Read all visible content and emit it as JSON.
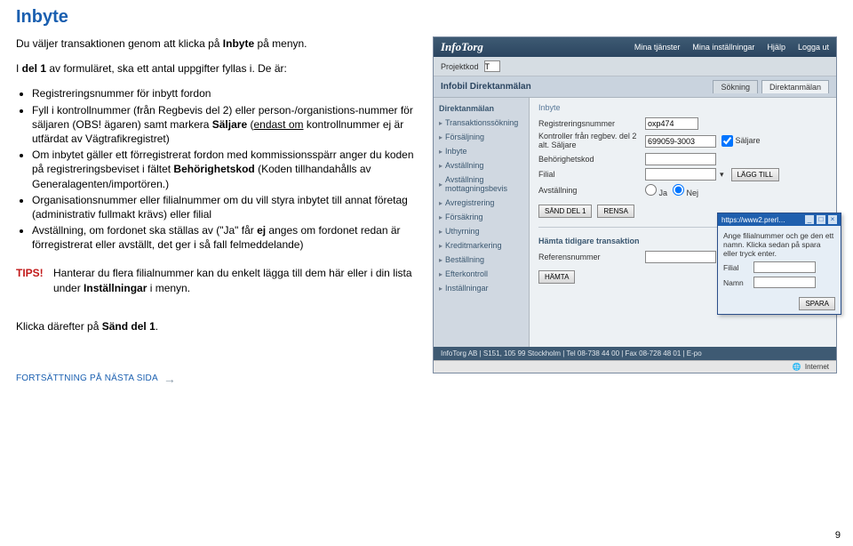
{
  "title": "Inbyte",
  "intro_l1_a": "Du väljer transaktionen genom att klicka på ",
  "intro_l1_b": "Inbyte",
  "intro_l1_c": " på menyn.",
  "intro_l2_a": "I ",
  "intro_l2_b": "del 1",
  "intro_l2_c": " av formuläret, ska ett antal uppgifter fyllas i. De är:",
  "bullets": {
    "b1_a": "Registreringsnummer för inbytt fordon",
    "b2_a": "Fyll i kontrollnummer (från Regbevis del 2) eller person-/organistions-nummer för säljaren (OBS! ägaren) samt markera ",
    "b2_b": "Säljare",
    "b2_c": " (",
    "b2_d": "endast om",
    "b2_e": " kontrollnummer ej är utfärdat av Vägtrafikregistret)",
    "b3_a": "Om inbytet gäller ett förregistrerat fordon med kommissionsspärr anger du koden på registreringsbeviset i fältet ",
    "b3_b": "Behörighetskod",
    "b3_c": " (Koden tillhandahålls av Generalagenten/importören.)",
    "b4_a": "Organisationsnummer eller filialnummer om du vill styra inbytet till annat företag (administrativ fullmakt krävs) eller filial",
    "b5_a": "Avställning, om fordonet ska ställas av (\"Ja\" får ",
    "b5_b": "ej",
    "b5_c": " anges om fordonet redan är förregistrerat eller avställt, det ger i så fall felmeddelande)"
  },
  "tips_label": "TIPS!",
  "tips_text_a": "Hanterar du flera filialnummer kan du enkelt lägga till dem här eller i din lista under ",
  "tips_text_b": "Inställningar",
  "tips_text_c": " i menyn.",
  "click_text_a": "Klicka därefter på ",
  "click_text_b": "Sänd del 1",
  "click_text_c": ".",
  "continue": "FORTSÄTTNING PÅ NÄSTA SIDA",
  "page_num": "9",
  "app": {
    "logo": "InfoTorg",
    "nav": [
      "Mina tjänster",
      "Mina inställningar",
      "Hjälp",
      "Logga ut"
    ],
    "projekt_label": "Projektkod",
    "projekt_value": "T",
    "panel_title": "Infobil Direktanmälan",
    "tabs": [
      "Sökning",
      "Direktanmälan"
    ],
    "sidebar_header": "Direktanmälan",
    "sidebar_items": [
      "Transaktionssökning",
      "Försäljning",
      "Inbyte",
      "Avställning",
      "Avställning mottagningsbevis",
      "Avregistrering",
      "Försäkring",
      "Uthyrning",
      "Kreditmarkering",
      "Beställning",
      "Efterkontroll",
      "Inställningar"
    ],
    "crumb": "Inbyte",
    "f_regnr_label": "Registreringsnummer",
    "f_regnr_value": "oxp474",
    "f_kontroller_label": "Kontroller från regbev. del 2 alt. Säljare",
    "f_kontroller_value": "699059-3003",
    "f_saljare_label": "Säljare",
    "f_behorig_label": "Behörighetskod",
    "f_filial_label": "Filial",
    "btn_lagg": "LÄGG TILL",
    "f_avst_label": "Avställning",
    "radio_ja": "Ja",
    "radio_nej": "Nej",
    "btn_send": "SÄND DEL 1",
    "btn_rensa": "RENSA",
    "sec2_title": "Hämta tidigare transaktion",
    "f_refnr_label": "Referensnummer",
    "btn_hamta": "HÄMTA",
    "footer": "InfoTorg AB | S151, 105 99 Stockholm | Tel 08-738 44 00 | Fax 08-728 48 01 | E-po",
    "status": "Internet"
  },
  "popup": {
    "url": "https://www2.prerl…",
    "text": "Ange filialnummer och ge den ett namn. Klicka sedan på spara eller tryck enter.",
    "filial_label": "Filial",
    "namn_label": "Namn",
    "btn_spara": "SPARA"
  }
}
